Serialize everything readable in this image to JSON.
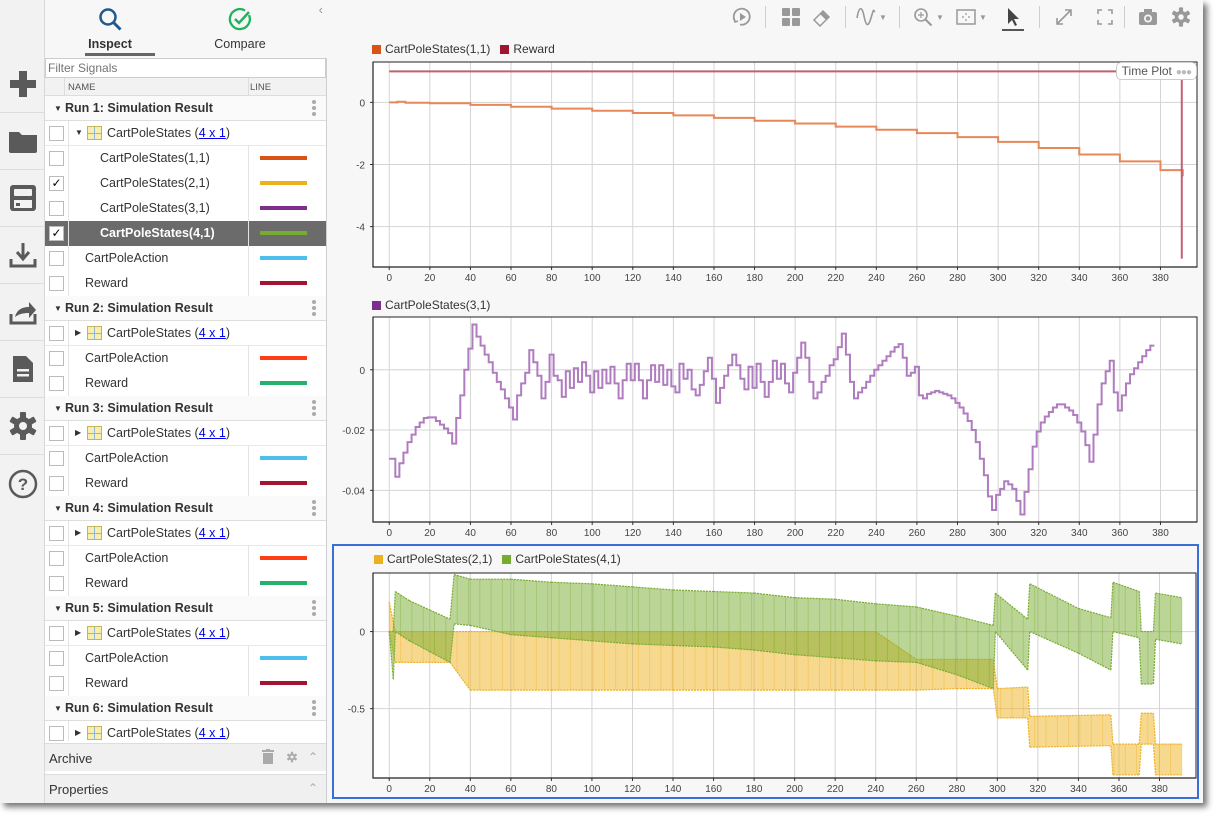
{
  "sidebar_icons": [
    {
      "name": "new-icon",
      "label": "New"
    },
    {
      "name": "open-folder-icon",
      "label": "Open"
    },
    {
      "name": "save-icon",
      "label": "Save"
    },
    {
      "name": "import-icon",
      "label": "Import"
    },
    {
      "name": "export-icon",
      "label": "Export"
    },
    {
      "name": "report-icon",
      "label": "Report"
    },
    {
      "name": "settings-icon",
      "label": "Preferences"
    },
    {
      "name": "help-icon",
      "label": "Help"
    }
  ],
  "tabs": [
    {
      "label": "Inspect",
      "icon": "search-icon",
      "active": true
    },
    {
      "label": "Compare",
      "icon": "check-circle-icon",
      "active": false
    }
  ],
  "filter": {
    "placeholder": "Filter Signals",
    "value": ""
  },
  "columns": {
    "name": "NAME",
    "line": "LINE"
  },
  "runs": [
    {
      "title": "Run 1: Simulation Result",
      "group": {
        "name": "CartPoleStates",
        "dims": "4 x 1",
        "expanded": true,
        "checked": false
      },
      "children": [
        {
          "name": "CartPoleStates(1,1)",
          "color": "#d95319",
          "checked": false,
          "selected": false
        },
        {
          "name": "CartPoleStates(2,1)",
          "color": "#edb120",
          "checked": true,
          "selected": false
        },
        {
          "name": "CartPoleStates(3,1)",
          "color": "#7e2f8e",
          "checked": false,
          "selected": false
        },
        {
          "name": "CartPoleStates(4,1)",
          "color": "#77ac30",
          "checked": true,
          "selected": true
        }
      ],
      "signals": [
        {
          "name": "CartPoleAction",
          "color": "#4dbeee",
          "checked": false
        },
        {
          "name": "Reward",
          "color": "#a2142f",
          "checked": false
        }
      ]
    },
    {
      "title": "Run 2: Simulation Result",
      "group": {
        "name": "CartPoleStates",
        "dims": "4 x 1",
        "expanded": false,
        "checked": false
      },
      "signals": [
        {
          "name": "CartPoleAction",
          "color": "#ff3d14",
          "checked": false
        },
        {
          "name": "Reward",
          "color": "#26b26c",
          "checked": false
        }
      ]
    },
    {
      "title": "Run 3: Simulation Result",
      "group": {
        "name": "CartPoleStates",
        "dims": "4 x 1",
        "expanded": false,
        "checked": false
      },
      "signals": [
        {
          "name": "CartPoleAction",
          "color": "#4dbeee",
          "checked": false
        },
        {
          "name": "Reward",
          "color": "#a2142f",
          "checked": false
        }
      ]
    },
    {
      "title": "Run 4: Simulation Result",
      "group": {
        "name": "CartPoleStates",
        "dims": "4 x 1",
        "expanded": false,
        "checked": false
      },
      "signals": [
        {
          "name": "CartPoleAction",
          "color": "#ff3d14",
          "checked": false
        },
        {
          "name": "Reward",
          "color": "#26b26c",
          "checked": false
        }
      ]
    },
    {
      "title": "Run 5: Simulation Result",
      "group": {
        "name": "CartPoleStates",
        "dims": "4 x 1",
        "expanded": false,
        "checked": false
      },
      "signals": [
        {
          "name": "CartPoleAction",
          "color": "#4dbeee",
          "checked": false
        },
        {
          "name": "Reward",
          "color": "#a2142f",
          "checked": false
        }
      ]
    },
    {
      "title": "Run 6: Simulation Result",
      "group": {
        "name": "CartPoleStates",
        "dims": "4 x 1",
        "expanded": false,
        "checked": false
      },
      "signals": []
    }
  ],
  "archive": {
    "label": "Archive"
  },
  "properties": {
    "label": "Properties"
  },
  "toolbar": [
    {
      "name": "replay-icon",
      "label": "Replay"
    },
    {
      "name": "layout-grid-icon",
      "label": "Visualizations and Layouts"
    },
    {
      "name": "eraser-icon",
      "label": "Clear Subplot"
    },
    {
      "name": "data-cursor-icon",
      "label": "Data Cursors",
      "dropdown": true
    },
    {
      "name": "zoom-in-icon",
      "label": "Zoom",
      "dropdown": true
    },
    {
      "name": "fit-to-view-icon",
      "label": "Fit to View",
      "dropdown": true
    },
    {
      "name": "pointer-icon",
      "label": "Pointer",
      "active": true
    },
    {
      "name": "expand-icon",
      "label": "Maximize Plot"
    },
    {
      "name": "fullscreen-icon",
      "label": "Full Screen"
    },
    {
      "name": "camera-icon",
      "label": "Snapshot"
    },
    {
      "name": "settings-icon",
      "label": "Settings"
    }
  ],
  "plot_badge": {
    "label": "Time Plot"
  },
  "chart_data": [
    {
      "type": "line",
      "title": "",
      "legend": [
        {
          "name": "CartPoleStates(1,1)",
          "color": "#d95319"
        },
        {
          "name": "Reward",
          "color": "#a2142f"
        }
      ],
      "legend_position": "top-left",
      "xlim": [
        -8,
        398
      ],
      "ylim": [
        -5.3,
        1.3
      ],
      "xticks": [
        0,
        20,
        40,
        60,
        80,
        100,
        120,
        140,
        160,
        180,
        200,
        220,
        240,
        260,
        280,
        300,
        320,
        340,
        360,
        380
      ],
      "yticks": [
        0,
        -2,
        -4
      ],
      "grid": true,
      "series": [
        {
          "name": "CartPoleStates(1,1)",
          "color": "#e8875a",
          "x": [
            0,
            4,
            8,
            20,
            40,
            60,
            80,
            100,
            120,
            140,
            160,
            180,
            200,
            220,
            240,
            260,
            280,
            300,
            320,
            340,
            360,
            380,
            391
          ],
          "y": [
            0,
            0.02,
            -0.01,
            -0.03,
            -0.08,
            -0.14,
            -0.2,
            -0.27,
            -0.34,
            -0.42,
            -0.5,
            -0.59,
            -0.68,
            -0.78,
            -0.88,
            -0.99,
            -1.12,
            -1.27,
            -1.47,
            -1.68,
            -1.9,
            -2.18,
            -2.38
          ]
        },
        {
          "name": "Reward",
          "color": "#c06070",
          "x": [
            0,
            390,
            390.5,
            391
          ],
          "y": [
            1,
            1,
            -5,
            -5
          ]
        }
      ]
    },
    {
      "type": "line",
      "legend": [
        {
          "name": "CartPoleStates(3,1)",
          "color": "#7e2f8e"
        }
      ],
      "legend_position": "top-left",
      "xlim": [
        -8,
        398
      ],
      "ylim": [
        -0.0505,
        0.0175
      ],
      "xticks": [
        0,
        20,
        40,
        60,
        80,
        100,
        120,
        140,
        160,
        180,
        200,
        220,
        240,
        260,
        280,
        300,
        320,
        340,
        360,
        380
      ],
      "yticks": [
        0,
        -0.02,
        -0.04
      ],
      "grid": true,
      "series": [
        {
          "name": "CartPoleStates(3,1)",
          "color": "#b07cc0",
          "x": [
            0,
            3,
            5,
            7,
            9,
            11,
            13,
            15,
            17,
            19,
            21,
            23,
            25,
            27,
            29,
            31,
            33,
            35,
            37,
            39,
            41,
            43,
            45,
            47,
            49,
            51,
            53,
            55,
            57,
            59,
            61,
            63,
            65,
            67,
            69,
            71,
            73,
            75,
            77,
            79,
            81,
            83,
            85,
            87,
            89,
            91,
            93,
            95,
            97,
            99,
            101,
            103,
            105,
            107,
            109,
            111,
            113,
            115,
            117,
            119,
            121,
            123,
            125,
            127,
            129,
            131,
            133,
            135,
            137,
            139,
            141,
            143,
            145,
            147,
            149,
            151,
            153,
            155,
            157,
            159,
            161,
            163,
            165,
            167,
            169,
            171,
            173,
            175,
            177,
            179,
            181,
            183,
            185,
            187,
            189,
            191,
            193,
            195,
            197,
            199,
            201,
            203,
            205,
            207,
            209,
            211,
            213,
            215,
            217,
            219,
            221,
            223,
            225,
            227,
            229,
            231,
            233,
            235,
            237,
            239,
            241,
            243,
            245,
            247,
            249,
            251,
            253,
            255,
            257,
            259,
            261,
            263,
            265,
            267,
            269,
            271,
            273,
            275,
            277,
            279,
            281,
            283,
            285,
            287,
            289,
            291,
            293,
            295,
            297,
            299,
            301,
            303,
            305,
            307,
            309,
            311,
            313,
            315,
            317,
            319,
            321,
            323,
            325,
            327,
            329,
            331,
            333,
            335,
            337,
            339,
            341,
            343,
            345,
            347,
            349,
            351,
            353,
            355,
            357,
            359,
            361,
            363,
            365,
            367,
            369,
            371,
            373,
            375,
            377,
            379,
            381,
            383,
            385,
            387,
            389,
            391
          ],
          "y": [
            -0.0295,
            -0.0355,
            -0.031,
            -0.0275,
            -0.024,
            -0.0215,
            -0.019,
            -0.0175,
            -0.016,
            -0.0158,
            -0.0158,
            -0.017,
            -0.0182,
            -0.0195,
            -0.021,
            -0.0245,
            -0.016,
            -0.0085,
            0,
            0.007,
            0.015,
            0.011,
            0.008,
            0.005,
            0.0025,
            -0.001,
            -0.004,
            -0.0065,
            -0.0095,
            -0.0125,
            -0.0165,
            -0.0085,
            -0.0045,
            -0.001,
            0.0065,
            0.0025,
            -0.002,
            -0.0095,
            -0.004,
            0.005,
            -0.002,
            -0.0035,
            -0.009,
            -0.0005,
            -0.006,
            0.0005,
            -0.004,
            0.0025,
            -0.002,
            -0.0075,
            -0.0005,
            -0.006,
            0,
            -0.0045,
            0.001,
            -0.0045,
            -0.0095,
            -0.0035,
            0.002,
            -0.0035,
            0.002,
            -0.0035,
            -0.0095,
            -0.0035,
            0.0015,
            -0.004,
            0.0015,
            -0.005,
            0,
            -0.0055,
            -0.0075,
            0.002,
            -0.003,
            0,
            -0.0065,
            -0.0085,
            -0.005,
            -0.0005,
            0.004,
            -0.003,
            -0.011,
            -0.006,
            -0.002,
            0.0015,
            0.005,
            0.0015,
            -0.003,
            -0.0065,
            0.001,
            -0.006,
            0.002,
            -0.004,
            -0.009,
            -0.004,
            0.003,
            -0.003,
            0.002,
            -0.0045,
            -0.0075,
            -0.001,
            0.004,
            0.009,
            0.004,
            -0.004,
            -0.0095,
            -0.0075,
            -0.004,
            -0.002,
            0.0015,
            0.0035,
            0.0075,
            0.012,
            0.005,
            -0.004,
            -0.0095,
            -0.0075,
            -0.006,
            -0.004,
            -0.002,
            0,
            0.0015,
            0.003,
            0.0045,
            0.006,
            0.0075,
            0.0085,
            0.004,
            -0.002,
            -0.001,
            0.001,
            -0.0085,
            -0.0095,
            -0.008,
            -0.0075,
            -0.007,
            -0.0075,
            -0.008,
            -0.0085,
            -0.0095,
            -0.011,
            -0.0125,
            -0.0145,
            -0.017,
            -0.02,
            -0.024,
            -0.0295,
            -0.035,
            -0.042,
            -0.0465,
            -0.0415,
            -0.0395,
            -0.037,
            -0.038,
            -0.0395,
            -0.0435,
            -0.048,
            -0.0405,
            -0.033,
            -0.0255,
            -0.0205,
            -0.0175,
            -0.0155,
            -0.014,
            -0.0125,
            -0.0115,
            -0.0115,
            -0.0125,
            -0.0135,
            -0.015,
            -0.0175,
            -0.0205,
            -0.025,
            -0.0305,
            -0.0215,
            -0.0115,
            -0.0045,
            -0.0005,
            0.003,
            -0.0075,
            -0.0135,
            -0.0085,
            -0.0045,
            -0.0015,
            0.0005,
            0.0025,
            0.0045,
            0.0065,
            0.008
          ]
        }
      ]
    },
    {
      "type": "area",
      "legend": [
        {
          "name": "CartPoleStates(2,1)",
          "color": "#edb120"
        },
        {
          "name": "CartPoleStates(4,1)",
          "color": "#77ac30"
        }
      ],
      "legend_position": "top-left",
      "xlim": [
        -8,
        398
      ],
      "ylim": [
        -0.95,
        0.38
      ],
      "xticks": [
        0,
        20,
        40,
        60,
        80,
        100,
        120,
        140,
        160,
        180,
        200,
        220,
        240,
        260,
        280,
        300,
        320,
        340,
        360,
        380
      ],
      "yticks": [
        0,
        -0.5
      ],
      "grid": true,
      "series": [
        {
          "name": "CartPoleStates(2,1)",
          "color": "#edb120",
          "note": "alternating bands between upper and lower envelopes",
          "x": [
            0,
            3,
            30,
            40,
            60,
            80,
            100,
            120,
            140,
            160,
            180,
            200,
            220,
            240,
            260,
            280,
            298,
            300,
            315,
            316,
            356,
            357,
            370,
            371,
            377,
            378,
            391
          ],
          "upper": [
            0.19,
            0.0,
            0.0,
            0.0,
            0.0,
            0.0,
            0.0,
            0.0,
            0.0,
            0.0,
            0.0,
            0.0,
            0.0,
            0.0,
            -0.18,
            -0.18,
            -0.18,
            -0.37,
            -0.36,
            -0.55,
            -0.54,
            -0.73,
            -0.73,
            -0.53,
            -0.53,
            -0.73,
            -0.73
          ],
          "lower": [
            0.0,
            -0.2,
            -0.2,
            -0.38,
            -0.38,
            -0.38,
            -0.38,
            -0.38,
            -0.38,
            -0.38,
            -0.38,
            -0.38,
            -0.38,
            -0.38,
            -0.38,
            -0.37,
            -0.37,
            -0.56,
            -0.56,
            -0.75,
            -0.74,
            -0.93,
            -0.93,
            -0.73,
            -0.73,
            -0.93,
            -0.93
          ]
        },
        {
          "name": "CartPoleStates(4,1)",
          "color": "#77ac30",
          "x": [
            0,
            2,
            3,
            10,
            20,
            30,
            32,
            40,
            60,
            80,
            100,
            120,
            140,
            160,
            180,
            200,
            220,
            240,
            260,
            280,
            298,
            299,
            315,
            316,
            340,
            356,
            357,
            370,
            371,
            377,
            378,
            391
          ],
          "upper": [
            0.0,
            0.0,
            0.26,
            0.2,
            0.14,
            0.08,
            0.37,
            0.34,
            0.34,
            0.32,
            0.31,
            0.29,
            0.27,
            0.26,
            0.25,
            0.22,
            0.21,
            0.18,
            0.16,
            0.1,
            0.04,
            0.25,
            0.08,
            0.31,
            0.15,
            0.09,
            0.32,
            0.26,
            0.0,
            0.0,
            0.25,
            0.22
          ],
          "lower": [
            0.0,
            -0.31,
            0.0,
            -0.06,
            -0.13,
            -0.2,
            0.05,
            0.04,
            -0.02,
            -0.04,
            -0.06,
            -0.08,
            -0.09,
            -0.1,
            -0.12,
            -0.15,
            -0.17,
            -0.19,
            -0.2,
            -0.28,
            -0.37,
            0.0,
            -0.25,
            0.0,
            -0.14,
            -0.25,
            0.0,
            -0.04,
            -0.34,
            -0.34,
            -0.05,
            -0.08
          ]
        }
      ]
    }
  ]
}
